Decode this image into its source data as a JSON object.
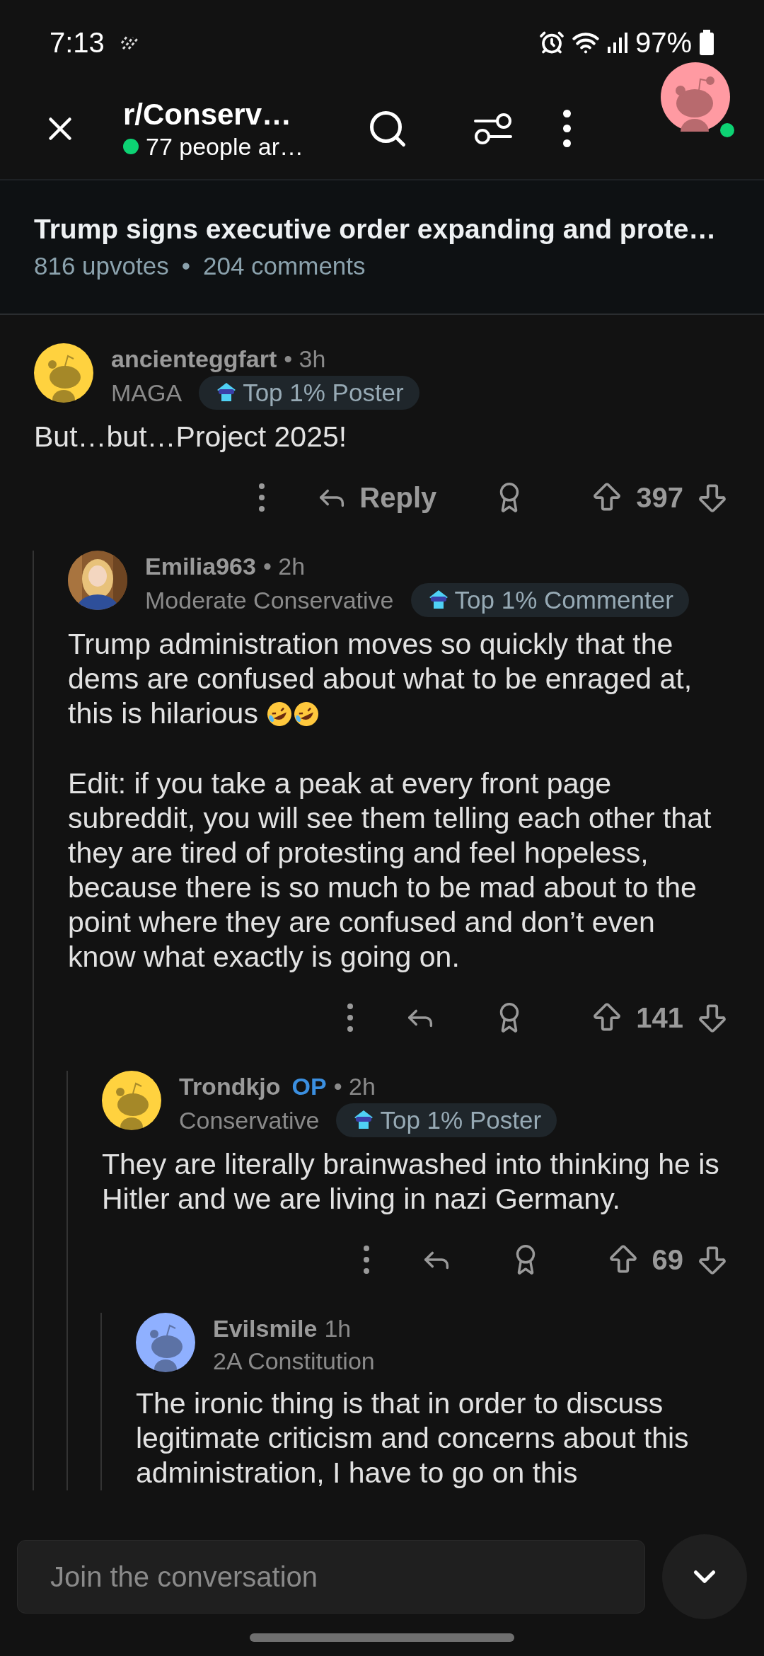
{
  "status_bar": {
    "time": "7:13",
    "battery": "97%"
  },
  "header": {
    "title": "r/Conserv…",
    "subtitle": "77 people ar…"
  },
  "post": {
    "title": "Trump signs executive order expanding and prote…",
    "stats": [
      "816 upvotes",
      "204 comments"
    ],
    "separator": "•"
  },
  "comments": [
    {
      "user": "ancienteggfart",
      "time": "• 3h",
      "flair": "MAGA",
      "badge": "Top 1% Poster",
      "avatar": {
        "kind": "snoo",
        "color": "#ffd23f"
      },
      "body": [
        "But…but…Project 2025!"
      ],
      "reply_label": "Reply",
      "votes": "397",
      "children": [
        {
          "user": "Emilia963",
          "time": "• 2h",
          "flair": "Moderate Conservative",
          "badge": "Top 1% Commenter",
          "avatar": {
            "kind": "picture"
          },
          "body": [
            "Trump administration moves so quickly that the dems are confused about what to be enraged at, this is hilarious",
            "Edit: if you take a peak at every front page subreddit, you will see them telling each other that they are tired of protesting and feel hopeless, because there is so much to be mad about to the point where they are confused and don’t even know what exactly is going on."
          ],
          "emojis": [
            {
              "kind": "rolling-laugh"
            },
            {
              "kind": "rolling-laugh"
            }
          ],
          "votes": "141",
          "children": [
            {
              "user": "Trondkjo",
              "op": "OP",
              "time": "• 2h",
              "flair": "Conservative",
              "badge": "Top 1% Poster",
              "avatar": {
                "kind": "snoo",
                "color": "#ffd23f"
              },
              "body": [
                "They are literally brainwashed into thinking he is Hitler and we are living in nazi Germany."
              ],
              "votes": "69",
              "children": [
                {
                  "user": "Evilsmile",
                  "time": "1h",
                  "flair": "2A Constitution",
                  "avatar": {
                    "kind": "snoo",
                    "color": "#8fb0ff"
                  },
                  "body": [
                    "The ironic thing is that in order to discuss legitimate criticism and concerns about this administration, I have to go on this"
                  ]
                }
              ]
            }
          ]
        }
      ]
    }
  ],
  "composer": {
    "placeholder": "Join the conversation"
  }
}
